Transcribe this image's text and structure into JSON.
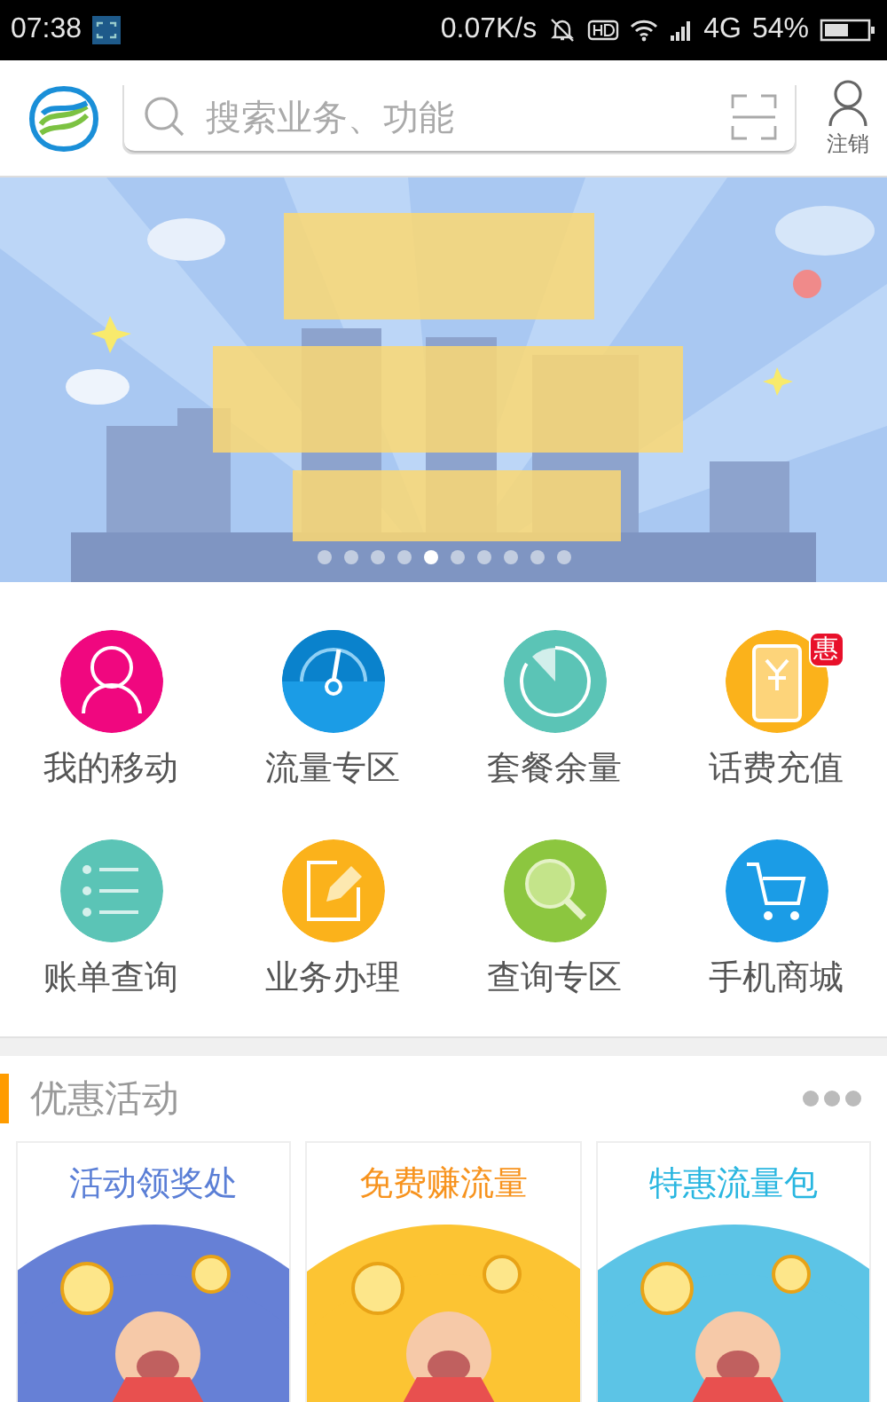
{
  "status_bar": {
    "time": "07:38",
    "speed": "0.07K/s",
    "network": "4G",
    "battery": "54%"
  },
  "header": {
    "search": {
      "placeholder": "搜索业务、功能"
    },
    "account": "注销"
  },
  "banner": {
    "kind": "picture",
    "dots": [
      {
        "selected": false
      },
      {
        "selected": false
      },
      {
        "selected": false
      },
      {
        "selected": false
      },
      {
        "selected": true
      },
      {
        "selected": false
      },
      {
        "selected": false
      },
      {
        "selected": false
      },
      {
        "selected": false
      },
      {
        "selected": false
      }
    ]
  },
  "services": [
    {
      "label": "我的移动",
      "kind": "person",
      "color": "#f0077f"
    },
    {
      "label": "流量专区",
      "kind": "gauge",
      "color": "#1b9ce6"
    },
    {
      "label": "套餐余量",
      "kind": "pie",
      "color": "#5bc4b6"
    },
    {
      "label": "话费充值",
      "kind": "phone",
      "color": "#fbb21b",
      "badge": "惠"
    },
    {
      "label": "账单查询",
      "kind": "list",
      "color": "#5bc4b6"
    },
    {
      "label": "业务办理",
      "kind": "edit",
      "color": "#fbb21b"
    },
    {
      "label": "查询专区",
      "kind": "magnifier",
      "color": "#8cc63f"
    },
    {
      "label": "手机商城",
      "kind": "cart",
      "color": "#1b9ce6"
    }
  ],
  "promotions": {
    "title": "优惠活动",
    "cards": [
      {
        "title": "活动领奖处",
        "color": "#5b7fd6"
      },
      {
        "title": "免费赚流量",
        "color": "#f7931e"
      },
      {
        "title": "特惠流量包",
        "color": "#29b6e0"
      }
    ]
  }
}
